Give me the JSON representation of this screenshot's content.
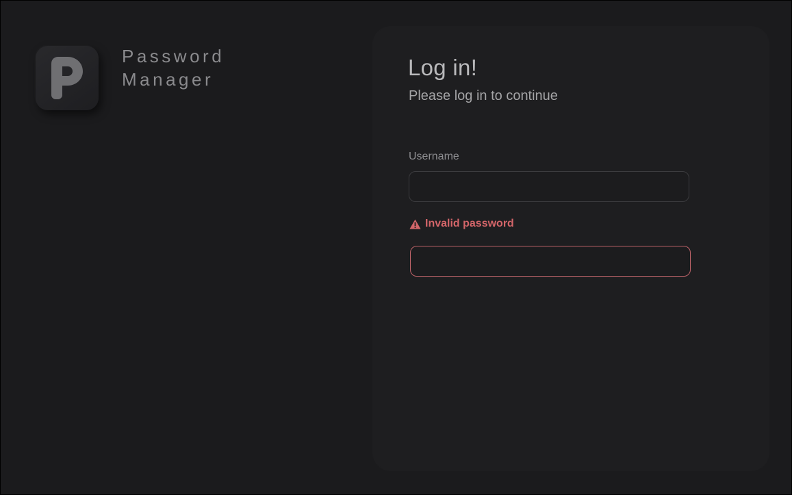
{
  "app": {
    "name_line1": "Password",
    "name_line2": "Manager",
    "logo_icon": "p-letter-logo"
  },
  "login": {
    "title": "Log in!",
    "subtitle": "Please log in to continue",
    "username_label": "Username",
    "username_value": "",
    "username_placeholder": "",
    "error_icon": "warning-icon",
    "error_message": "Invalid password",
    "password_value": "",
    "password_placeholder": ""
  },
  "colors": {
    "background": "#1b1b1d",
    "card": "#1e1e20",
    "error": "#d36569",
    "error_border": "#c0646a",
    "text_primary": "#b9b9bb",
    "text_muted": "#8a8a8d"
  }
}
